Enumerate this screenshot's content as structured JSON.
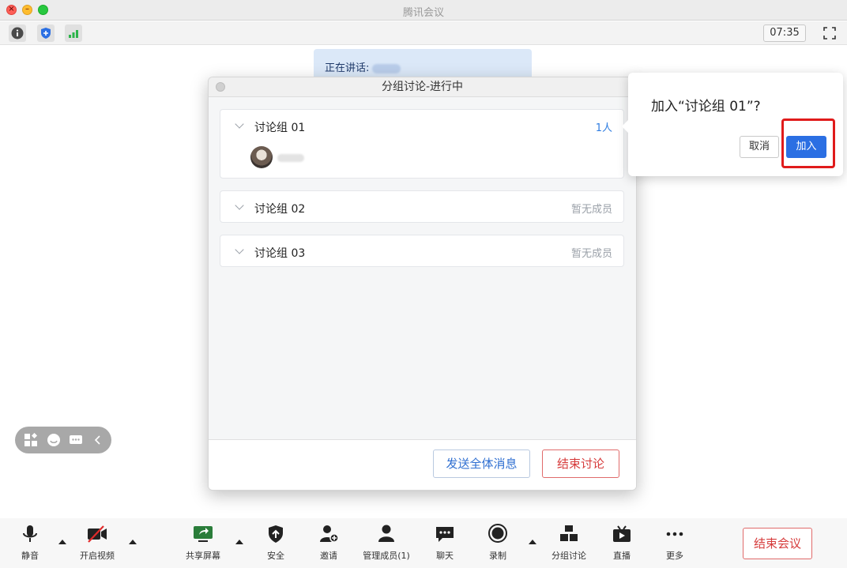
{
  "window": {
    "title": "腾讯会议"
  },
  "topbar": {
    "timer": "07:35",
    "icons": [
      "info-icon",
      "shield-icon",
      "signal-icon",
      "fullscreen-icon"
    ]
  },
  "speaking": {
    "label": "正在讲话:"
  },
  "breakout_panel": {
    "title": "分组讨论-进行中",
    "groups": [
      {
        "name": "讨论组 01",
        "status": "1人",
        "expanded": true
      },
      {
        "name": "讨论组 02",
        "status": "暂无成员",
        "expanded": false
      },
      {
        "name": "讨论组 03",
        "status": "暂无成员",
        "expanded": false
      }
    ],
    "broadcast_label": "发送全体消息",
    "end_discussion_label": "结束讨论"
  },
  "join_popover": {
    "title": "加入“讨论组 01”?",
    "cancel_label": "取消",
    "join_label": "加入"
  },
  "toolbar": {
    "mute": "静音",
    "video": "开启视频",
    "share": "共享屏幕",
    "security": "安全",
    "invite": "邀请",
    "members": "管理成员(1)",
    "chat": "聊天",
    "record": "录制",
    "breakout": "分组讨论",
    "live": "直播",
    "more": "更多",
    "end_meeting": "结束会议"
  },
  "colors": {
    "accent": "#2b6fe3",
    "danger": "#d63b3b",
    "highlight": "#e01b1b",
    "speaking_bg": "#dbe8f8"
  }
}
